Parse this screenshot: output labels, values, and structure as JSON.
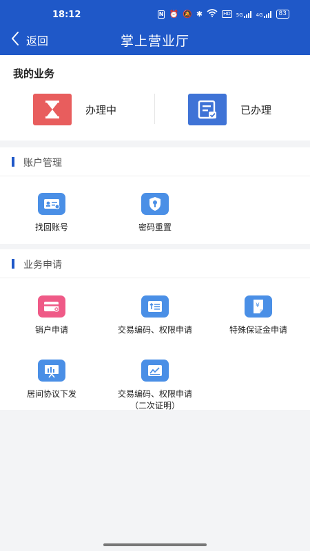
{
  "status_bar": {
    "time": "18:12",
    "nfc": "N",
    "net_5g": "5G",
    "net_4g": "4G",
    "hd": "HD",
    "battery": "83"
  },
  "nav": {
    "back_label": "返回",
    "title": "掌上营业厅"
  },
  "my_business": {
    "heading": "我的业务",
    "items": [
      {
        "label": "办理中",
        "color": "#e85d5d",
        "icon": "hourglass-icon"
      },
      {
        "label": "已办理",
        "color": "#3f73d6",
        "icon": "document-check-icon"
      }
    ]
  },
  "account_management": {
    "heading": "账户管理",
    "items": [
      {
        "label": "找回账号",
        "icon": "id-card-icon",
        "color": "#4a8fe6"
      },
      {
        "label": "密码重置",
        "icon": "key-shield-icon",
        "color": "#4a8fe6"
      }
    ]
  },
  "business_application": {
    "heading": "业务申请",
    "items": [
      {
        "label": "销户申请",
        "icon": "card-cancel-icon",
        "color": "#ef5a87"
      },
      {
        "label": "交易编码、权限申请",
        "icon": "code-list-icon",
        "color": "#4a8fe6"
      },
      {
        "label": "特殊保证金申请",
        "icon": "yen-document-icon",
        "color": "#4a8fe6"
      },
      {
        "label": "居间协议下发",
        "icon": "chart-board-icon",
        "color": "#4a8fe6"
      },
      {
        "label": "交易编码、权限申请",
        "label2": "（二次证明）",
        "icon": "trend-chart-icon",
        "color": "#4a8fe6"
      }
    ]
  }
}
